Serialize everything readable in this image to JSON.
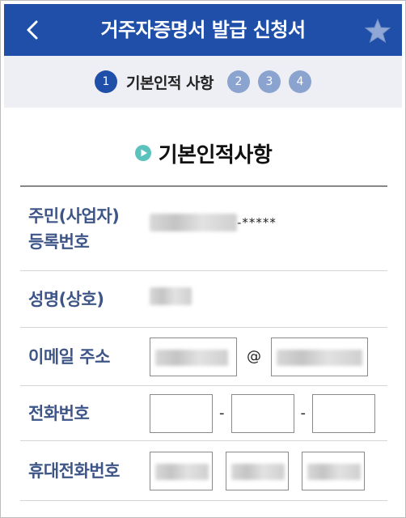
{
  "header": {
    "title": "거주자증명서 발급 신청서",
    "back_icon": "chevron-left-icon",
    "star_icon": "star-icon",
    "bg_color": "#1f4fa8"
  },
  "steps": {
    "items": [
      "1",
      "2",
      "3",
      "4"
    ],
    "active_label": "기본인적 사항"
  },
  "section": {
    "title": "기본인적사항",
    "icon": "play-circle-icon",
    "icon_color": "#5cc2bd"
  },
  "form": {
    "rrn_label_line1": "주민(사업자)",
    "rrn_label_line2": "등록번호",
    "rrn_masked_suffix": "-*****",
    "name_label": "성명(상호)",
    "email_label": "이메일 주소",
    "email_at": "@",
    "phone_label": "전화번호",
    "phone_sep1": "-",
    "phone_sep2": "-",
    "mobile_label": "휴대전화번호",
    "label_color": "#3d5587"
  }
}
